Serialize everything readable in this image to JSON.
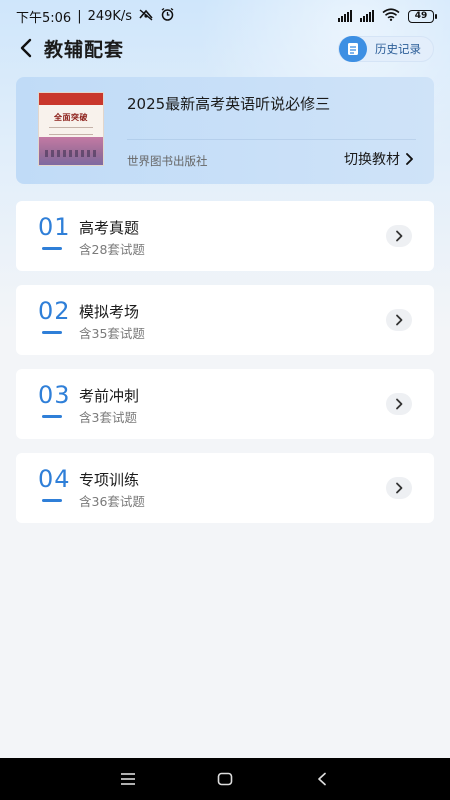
{
  "status_bar": {
    "time": "下午5:06",
    "speed": "249K/s",
    "battery": "49"
  },
  "header": {
    "title": "教辅配套",
    "history_label": "历史记录"
  },
  "book": {
    "title": "2025最新高考英语听说必修三",
    "publisher": "世界图书出版社",
    "switch_label": "切换教材",
    "cover_text": "全面突破"
  },
  "items": [
    {
      "number": "01",
      "title": "高考真题",
      "subtitle": "含28套试题"
    },
    {
      "number": "02",
      "title": "模拟考场",
      "subtitle": "含35套试题"
    },
    {
      "number": "03",
      "title": "考前冲刺",
      "subtitle": "含3套试题"
    },
    {
      "number": "04",
      "title": "专项训练",
      "subtitle": "含36套试题"
    }
  ],
  "colors": {
    "accent": "#2f7fd8",
    "history_icon_bg": "#3d8fe3",
    "background": "#f3f5f8"
  }
}
